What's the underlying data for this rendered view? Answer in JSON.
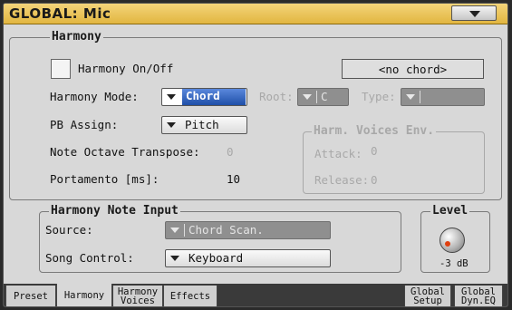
{
  "window": {
    "title": "GLOBAL: Mic"
  },
  "harmony": {
    "group_title": "Harmony",
    "on_off_label": "Harmony On/Off",
    "chord_display": "<no chord>",
    "mode_label": "Harmony Mode:",
    "mode_value": "Chord",
    "root_label": "Root:",
    "root_value": "C",
    "type_label": "Type:",
    "type_value": "",
    "pb_assign_label": "PB Assign:",
    "pb_assign_value": "Pitch",
    "octave_label": "Note Octave Transpose:",
    "octave_value": "0",
    "portamento_label": "Portamento [ms]:",
    "portamento_value": "10"
  },
  "voices_env": {
    "group_title": "Harm. Voices Env.",
    "attack_label": "Attack:",
    "attack_value": "0",
    "release_label": "Release:",
    "release_value": "0"
  },
  "note_input": {
    "group_title": "Harmony Note Input",
    "source_label": "Source:",
    "source_value": "Chord Scan.",
    "song_control_label": "Song Control:",
    "song_control_value": "Keyboard"
  },
  "level": {
    "group_title": "Level",
    "value": "-3 dB"
  },
  "tabs": [
    {
      "label": "Preset"
    },
    {
      "label": "Harmony"
    },
    {
      "label": "Harmony\nVoices"
    },
    {
      "label": "Effects"
    },
    {
      "label": "Global\nSetup"
    },
    {
      "label": "Global\nDyn.EQ"
    }
  ]
}
